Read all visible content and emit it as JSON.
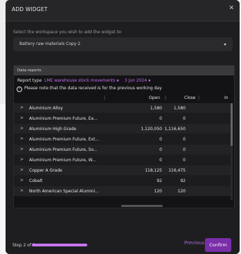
{
  "modal": {
    "title": "ADD WIDGET",
    "close_icon": "close-icon"
  },
  "workspace": {
    "instruction": "Select the workspace you wish to add the widget to:",
    "selected": "Battery raw materials Copy 2"
  },
  "reports": {
    "header": "Data reports",
    "report_type_label": "Report type",
    "report_type_value": "LME warehouse stock movements",
    "date_value": "3 Jun 2024",
    "notice": "Please note that the data received is for the previous working day",
    "columns": {
      "open": "Open",
      "close": "Close",
      "in": "In"
    },
    "rows": [
      {
        "name": "Aluminium Alloy",
        "open": "1,580",
        "close": "1,580"
      },
      {
        "name": "Aluminium Premium Future, Ea...",
        "open": "0",
        "close": "0"
      },
      {
        "name": "Aluminium High Grade",
        "open": "1,120,050",
        "close": "1,116,650"
      },
      {
        "name": "Aluminium Premium Future, Ext...",
        "open": "0",
        "close": "0"
      },
      {
        "name": "Aluminium Premium Future, So...",
        "open": "0",
        "close": "0"
      },
      {
        "name": "Aluminium Premium Future, W...",
        "open": "0",
        "close": "0"
      },
      {
        "name": "Copper A Grade",
        "open": "118,125",
        "close": "116,475"
      },
      {
        "name": "Cobalt",
        "open": "92",
        "close": "92"
      },
      {
        "name": "North American Special Alumini...",
        "open": "120",
        "close": "120"
      }
    ]
  },
  "footer": {
    "step_text": "Step 2 of 2",
    "progress": 1.0,
    "previous_label": "Previous",
    "confirm_label": "Confirm"
  },
  "colors": {
    "accent": "#c876f0",
    "confirm_bg": "#7a2ea8",
    "modal_bg": "#1e1e20"
  }
}
